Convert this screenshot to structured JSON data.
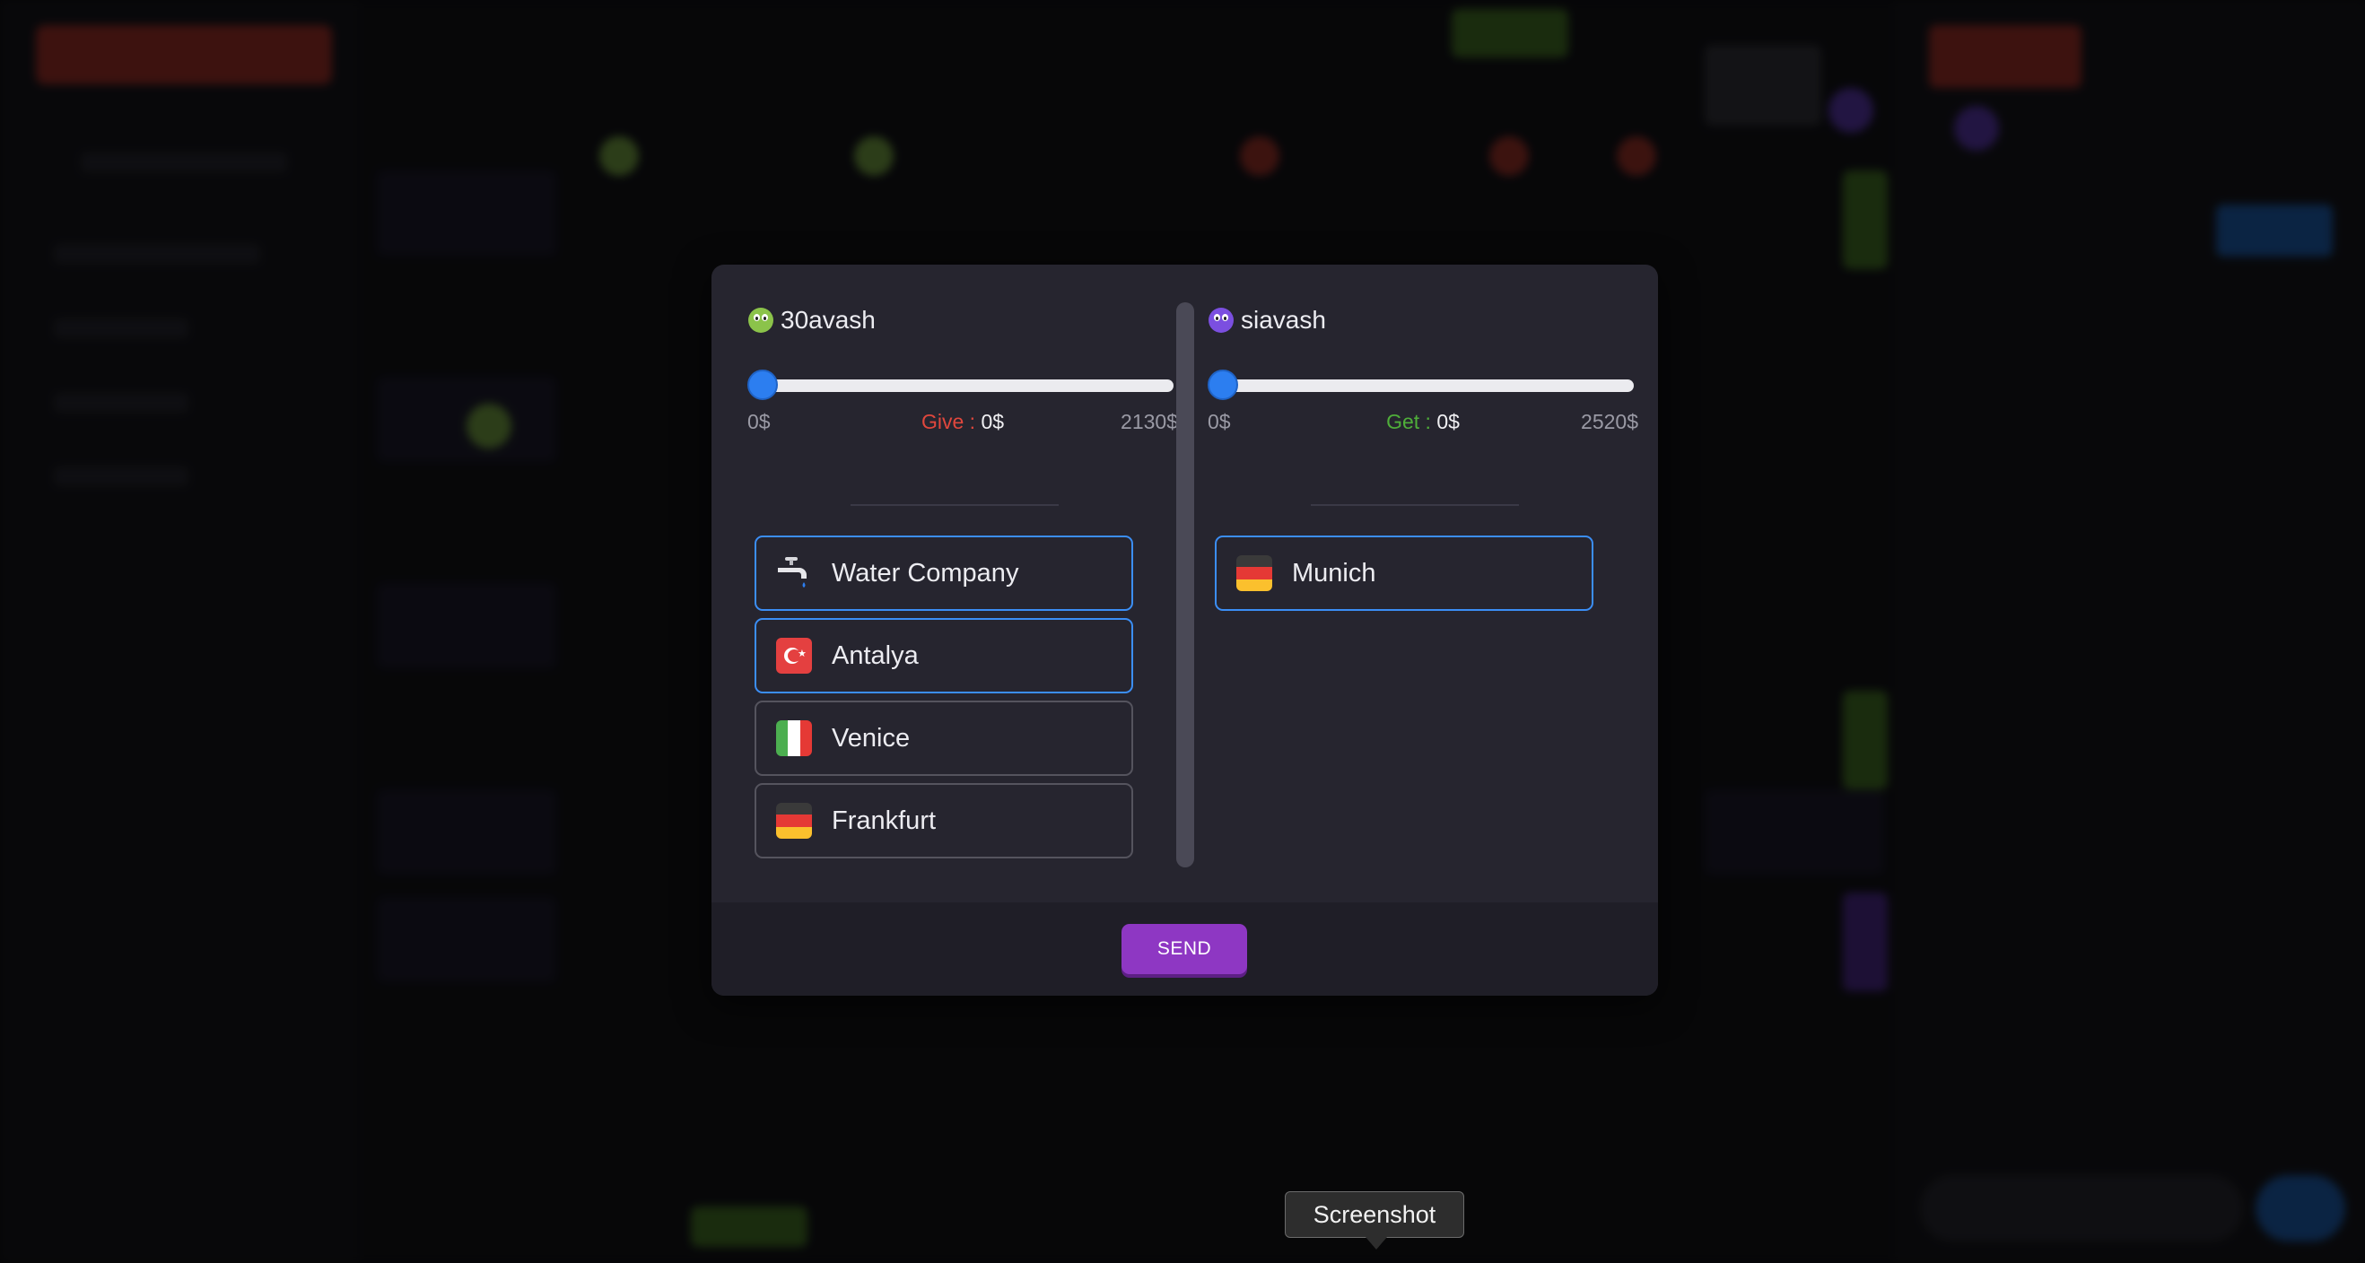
{
  "colors": {
    "give": "#e0473d",
    "get": "#4fae3a",
    "send": "#8e37c3",
    "accent": "#2c7ef0",
    "player_left_avatar": "#8bc34a",
    "player_right_avatar": "#7b4fe0"
  },
  "trade": {
    "left": {
      "player": "30avash",
      "min": "0$",
      "max": "2130$",
      "label": "Give : ",
      "value": "0$",
      "slider_fraction": 0,
      "properties": [
        {
          "name": "Water Company",
          "icon": "water-tap-icon",
          "selected": true
        },
        {
          "name": "Antalya",
          "icon": "turkey-flag-icon",
          "selected": true
        },
        {
          "name": "Venice",
          "icon": "italy-flag-icon",
          "selected": false
        },
        {
          "name": "Frankfurt",
          "icon": "germany-flag-icon",
          "selected": false
        }
      ]
    },
    "right": {
      "player": "siavash",
      "min": "0$",
      "max": "2520$",
      "label": "Get : ",
      "value": "0$",
      "slider_fraction": 0,
      "properties": [
        {
          "name": "Munich",
          "icon": "germany-flag-icon",
          "selected": true
        }
      ]
    },
    "send_label": "SEND"
  },
  "tooltip": "Screenshot"
}
